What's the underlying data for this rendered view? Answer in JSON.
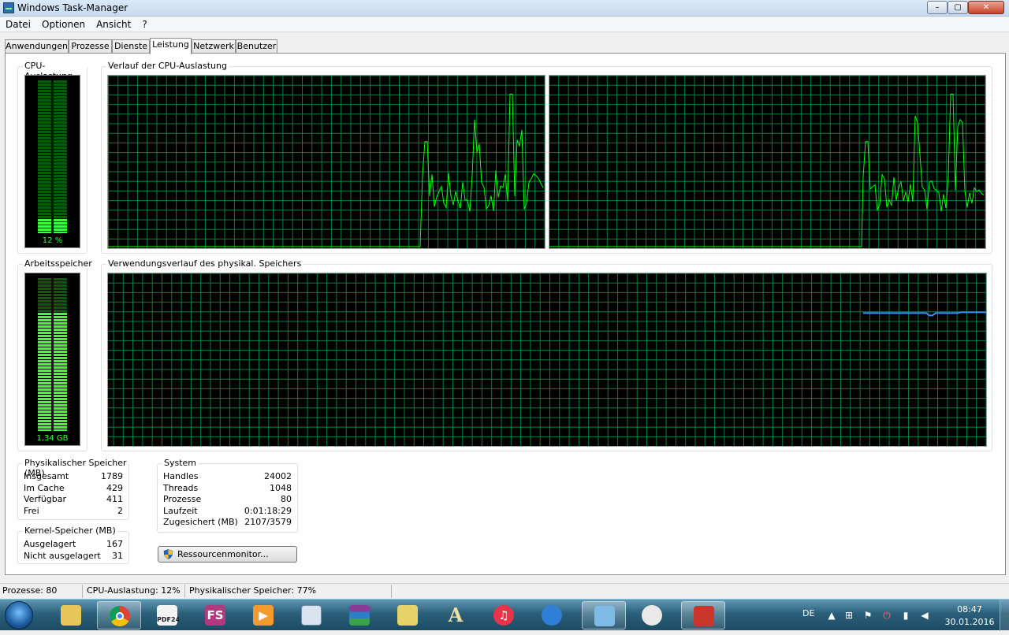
{
  "window": {
    "title": "Windows Task-Manager",
    "min_symbol": "–",
    "max_symbol": "▢",
    "close_symbol": "✕"
  },
  "menu": [
    "Datei",
    "Optionen",
    "Ansicht",
    "?"
  ],
  "tabs": [
    "Anwendungen",
    "Prozesse",
    "Dienste",
    "Leistung",
    "Netzwerk",
    "Benutzer"
  ],
  "active_tab": "Leistung",
  "cpu": {
    "label": "CPU-Auslastung",
    "value": "12 %",
    "level": 0.12
  },
  "cpu_history": {
    "label": "Verlauf der CPU-Auslastung"
  },
  "memory": {
    "label": "Arbeitsspeicher",
    "value": "1,34 GB",
    "level": 0.77
  },
  "memory_history": {
    "label": "Verwendungsverlauf des physikal. Speichers"
  },
  "physical": {
    "label": "Physikalischer Speicher (MB)",
    "rows": [
      {
        "k": "Insgesamt",
        "v": "1789"
      },
      {
        "k": "Im Cache",
        "v": "429"
      },
      {
        "k": "Verfügbar",
        "v": "411"
      },
      {
        "k": "Frei",
        "v": "2"
      }
    ]
  },
  "kernel": {
    "label": "Kernel-Speicher (MB)",
    "rows": [
      {
        "k": "Ausgelagert",
        "v": "167"
      },
      {
        "k": "Nicht ausgelagert",
        "v": "31"
      }
    ]
  },
  "system": {
    "label": "System",
    "rows": [
      {
        "k": "Handles",
        "v": "24002"
      },
      {
        "k": "Threads",
        "v": "1048"
      },
      {
        "k": "Prozesse",
        "v": "80"
      },
      {
        "k": "Laufzeit",
        "v": "0:01:18:29"
      },
      {
        "k": "Zugesichert (MB)",
        "v": "2107/3579"
      }
    ]
  },
  "resmon_label": "Ressourcenmonitor...",
  "statusbar": {
    "processes": "Prozesse: 80",
    "cpu": "CPU-Auslastung: 12%",
    "memory": "Physikalischer Speicher: 77%"
  },
  "taskbar": {
    "apps": [
      "explorer-icon",
      "chrome-icon",
      "pdf24-icon",
      "fs-icon",
      "media-icon",
      "calculator-icon",
      "winrar-icon",
      "folder-icon",
      "font-icon",
      "itunes-icon",
      "mail-icon",
      "ipod-icon",
      "paint-icon",
      "ccleaner-icon"
    ],
    "fs_label": "FS",
    "pdf_label": "PDF24"
  },
  "tray": {
    "lang": "DE",
    "time": "08:47",
    "date": "30.01.2016"
  },
  "colors": {
    "grid": "#008040",
    "cpu_line": "#00ff00",
    "mem_line": "#3c8dff",
    "meter_green": "#3dff3d"
  }
}
